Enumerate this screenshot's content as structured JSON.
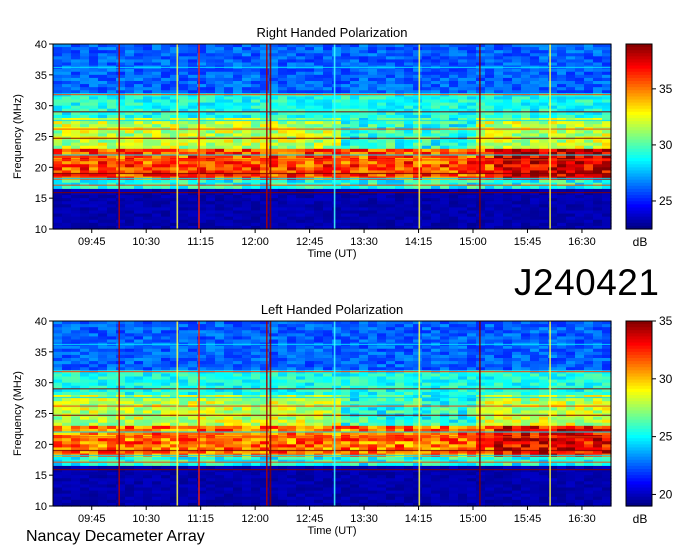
{
  "station_id": "J240421",
  "footer": "Nancay Decameter Array",
  "chart_data": [
    {
      "type": "heatmap",
      "title": "Right Handed Polarization",
      "xlabel": "Time (UT)",
      "ylabel": "Frequency (MHz)",
      "xlim": [
        "09:13",
        "16:54"
      ],
      "ylim": [
        10,
        40
      ],
      "xticks": [
        "09:45",
        "10:30",
        "11:15",
        "12:00",
        "12:45",
        "13:30",
        "14:15",
        "15:00",
        "15:45",
        "16:30"
      ],
      "yticks": [
        10,
        15,
        20,
        25,
        30,
        35,
        40
      ],
      "colorbar": {
        "label": "dB",
        "range": [
          22.5,
          39
        ],
        "ticks": [
          25,
          30,
          35
        ]
      }
    },
    {
      "type": "heatmap",
      "title": "Left Handed Polarization",
      "xlabel": "Time (UT)",
      "ylabel": "Frequency (MHz)",
      "xlim": [
        "09:13",
        "16:54"
      ],
      "ylim": [
        10,
        40
      ],
      "xticks": [
        "09:45",
        "10:30",
        "11:15",
        "12:00",
        "12:45",
        "13:30",
        "14:15",
        "15:00",
        "15:45",
        "16:30"
      ],
      "yticks": [
        10,
        15,
        20,
        25,
        30,
        35,
        40
      ],
      "colorbar": {
        "label": "dB",
        "range": [
          19,
          35
        ],
        "ticks": [
          20,
          25,
          30,
          35
        ]
      }
    }
  ],
  "colormap": [
    "#00007f",
    "#0000ff",
    "#007fff",
    "#00ffff",
    "#7fff7f",
    "#ffff00",
    "#ff7f00",
    "#ff0000",
    "#7f0000"
  ]
}
